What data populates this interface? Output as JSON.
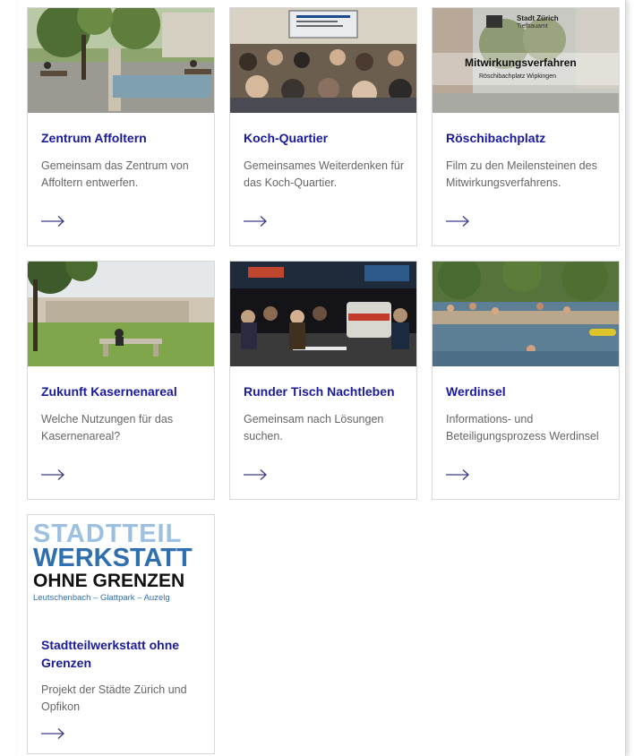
{
  "cards": [
    {
      "title": "Zentrum Affoltern",
      "desc": "Gemeinsam das Zentrum von Affoltern entwerfen.",
      "arrow_icon": "arrow-right-icon"
    },
    {
      "title": "Koch-Quartier",
      "desc": "Gemeinsames Weiterdenken für das Koch-Quartier.",
      "arrow_icon": "arrow-right-icon"
    },
    {
      "title": "Röschibachplatz",
      "desc": "Film zu den Meilensteinen des Mitwirkungsverfahrens.",
      "arrow_icon": "arrow-right-icon",
      "image_text": {
        "brand": "Stadt Zürich",
        "dept": "Tiefbauamt",
        "headline": "Mitwirkungsverfahren",
        "sub": "Röschibachplatz Wipkingen"
      }
    },
    {
      "title": "Zukunft Kasernenareal",
      "desc": "Welche Nutzungen für das Kasernenareal?",
      "arrow_icon": "arrow-right-icon"
    },
    {
      "title": "Runder Tisch Nachtleben",
      "desc": "Gemeinsam nach Lösungen suchen.",
      "arrow_icon": "arrow-right-icon"
    },
    {
      "title": "Werdinsel",
      "desc": "Informations- und Beteiligungsprozess Werdinsel",
      "arrow_icon": "arrow-right-icon"
    },
    {
      "title": "Stadtteilwerkstatt ohne Grenzen",
      "desc": "Projekt der Städte Zürich und Opfikon",
      "arrow_icon": "arrow-right-icon",
      "image_text": {
        "line1": "STADTTEIL",
        "line2": "WERKSTATT",
        "line3": "OHNE GRENZEN",
        "line4": "Leutschenbach – Glattpark – Auzelg"
      }
    }
  ],
  "colors": {
    "title": "#1a1a9c",
    "desc": "#666666",
    "arrow": "#3a3a8c",
    "border": "#d9d9d9"
  }
}
